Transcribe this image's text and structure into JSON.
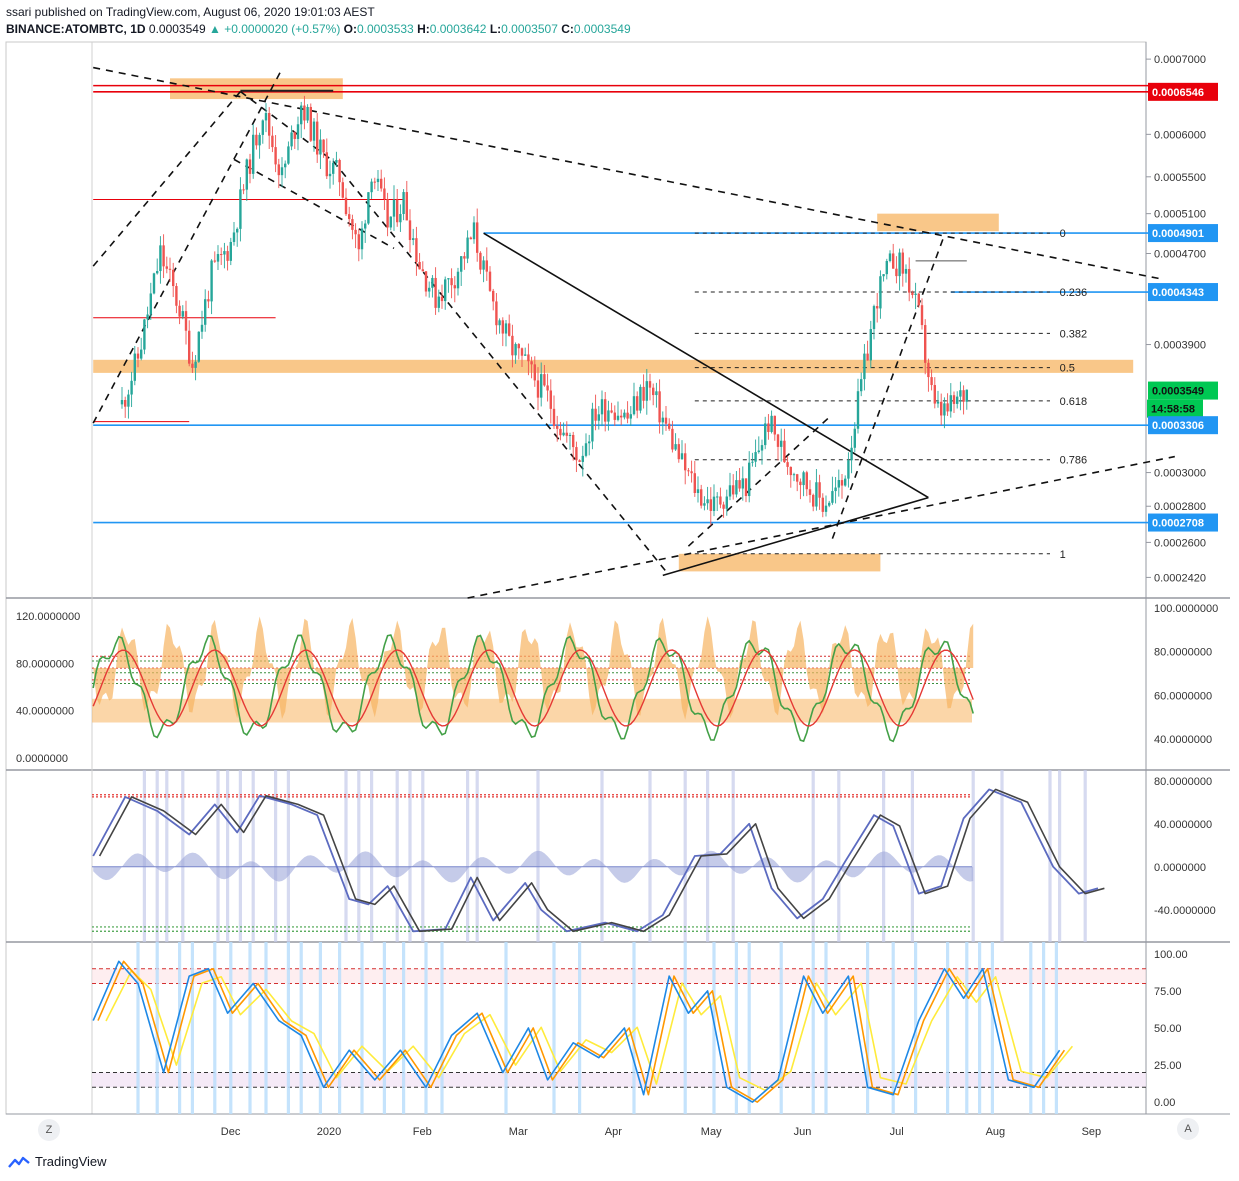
{
  "header": {
    "published_by": "ssari published on TradingView.com, August 06, 2020 19:01:03 AEST",
    "symbol": "BINANCE:ATOMBTC, 1D",
    "last": "0.0003549",
    "change_icon": "triangle-up-icon",
    "change": "+0.0000020 (+0.57%)",
    "o_label": "O:",
    "o": "0.0003533",
    "h_label": "H:",
    "h": "0.0003642",
    "l_label": "L:",
    "l": "0.0003507",
    "c_label": "C:",
    "c": "0.0003549"
  },
  "footer": {
    "brand": "TradingView",
    "left_button": "Z",
    "right_button": "A"
  },
  "colors": {
    "up": "#26a69a",
    "down": "#ef5350",
    "red_line": "#e8000b",
    "blue_line": "#2196f3",
    "zone": "#f7b461",
    "green_label": "#00c853"
  },
  "chart_data": [
    {
      "type": "candlestick",
      "symbol": "BINANCE:ATOMBTC",
      "interval": "1D",
      "x_ticks": [
        "Dec",
        "2020",
        "Feb",
        "Mar",
        "Apr",
        "May",
        "Jun",
        "Jul",
        "Aug",
        "Sep"
      ],
      "y_ticks": [
        "0.0007000",
        "0.0006000",
        "0.0005500",
        "0.0005100",
        "0.0004700",
        "0.0003900",
        "0.0003000",
        "0.0002800",
        "0.0002600",
        "0.0002420"
      ],
      "ylim": [
        0.000232,
        0.000725
      ],
      "y_scale": "log",
      "price_labels": [
        {
          "text": "0.0006546",
          "kind": "red"
        },
        {
          "text": "0.0004901",
          "kind": "blue"
        },
        {
          "text": "0.0004343",
          "kind": "blue"
        },
        {
          "text": "0.0003549",
          "kind": "green"
        },
        {
          "text": "14:58:58",
          "kind": "green"
        },
        {
          "text": "0.0003306",
          "kind": "blue"
        },
        {
          "text": "0.0002708",
          "kind": "blue"
        }
      ],
      "fib_levels": [
        {
          "label": "0",
          "price": 0.0004901
        },
        {
          "label": "0.236",
          "price": 0.0004343
        },
        {
          "label": "0.382",
          "price": 0.000399
        },
        {
          "label": "0.5",
          "price": 0.000372
        },
        {
          "label": "0.618",
          "price": 0.0003475
        },
        {
          "label": "0.786",
          "price": 0.000308
        },
        {
          "label": "1",
          "price": 0.000254
        }
      ],
      "close_path": [
        [
          0,
          0.000345
        ],
        [
          5,
          0.00038
        ],
        [
          12,
          0.00047
        ],
        [
          18,
          0.00042
        ],
        [
          22,
          0.000375
        ],
        [
          28,
          0.00045
        ],
        [
          34,
          0.00048
        ],
        [
          40,
          0.00057
        ],
        [
          44,
          0.00063
        ],
        [
          50,
          0.00055
        ],
        [
          56,
          0.00064
        ],
        [
          63,
          0.00057
        ],
        [
          68,
          0.00055
        ],
        [
          74,
          0.00047
        ],
        [
          78,
          0.00056
        ],
        [
          83,
          0.0005
        ],
        [
          88,
          0.000525
        ],
        [
          93,
          0.00046
        ],
        [
          98,
          0.00043
        ],
        [
          104,
          0.00045
        ],
        [
          110,
          0.00049
        ],
        [
          115,
          0.00043
        ],
        [
          121,
          0.00039
        ],
        [
          127,
          0.00037
        ],
        [
          133,
          0.00035
        ],
        [
          138,
          0.000325
        ],
        [
          143,
          0.00031
        ],
        [
          148,
          0.00034
        ],
        [
          153,
          0.000345
        ],
        [
          158,
          0.000335
        ],
        [
          164,
          0.00036
        ],
        [
          170,
          0.00033
        ],
        [
          175,
          0.000305
        ],
        [
          180,
          0.000288
        ],
        [
          185,
          0.00028
        ],
        [
          190,
          0.00029
        ],
        [
          195,
          0.000293
        ],
        [
          202,
          0.000333
        ],
        [
          207,
          0.00031
        ],
        [
          213,
          0.000295
        ],
        [
          219,
          0.000282
        ],
        [
          225,
          0.000292
        ],
        [
          230,
          0.000345
        ],
        [
          236,
          0.000432
        ],
        [
          241,
          0.000465
        ],
        [
          245,
          0.000452
        ],
        [
          249,
          0.000412
        ],
        [
          254,
          0.00034
        ],
        [
          258,
          0.00034
        ],
        [
          264,
          0.000355
        ]
      ]
    },
    {
      "type": "line",
      "name": "oscillator-1",
      "y_ticks_left": [
        "120.0000000",
        "80.0000000",
        "40.0000000",
        "0.0000000"
      ],
      "y_ticks_right": [
        "100.0000000",
        "80.0000000",
        "60.0000000",
        "40.0000000"
      ],
      "ylim": [
        0,
        120
      ]
    },
    {
      "type": "line",
      "name": "oscillator-2",
      "y_ticks": [
        "80.0000000",
        "40.0000000",
        "0.0000000",
        "-40.0000000"
      ],
      "ylim": [
        -70,
        90
      ],
      "key_points": [
        [
          0,
          10
        ],
        [
          10,
          65
        ],
        [
          20,
          52
        ],
        [
          30,
          30
        ],
        [
          38,
          58
        ],
        [
          45,
          32
        ],
        [
          52,
          66
        ],
        [
          62,
          58
        ],
        [
          70,
          48
        ],
        [
          80,
          -30
        ],
        [
          86,
          -35
        ],
        [
          92,
          -18
        ],
        [
          100,
          -60
        ],
        [
          110,
          -58
        ],
        [
          118,
          -10
        ],
        [
          125,
          -50
        ],
        [
          135,
          -15
        ],
        [
          140,
          -40
        ],
        [
          148,
          -60
        ],
        [
          160,
          -52
        ],
        [
          170,
          -60
        ],
        [
          178,
          -45
        ],
        [
          188,
          10
        ],
        [
          196,
          12
        ],
        [
          205,
          40
        ],
        [
          212,
          -20
        ],
        [
          220,
          -48
        ],
        [
          228,
          -30
        ],
        [
          235,
          5
        ],
        [
          244,
          48
        ],
        [
          250,
          38
        ],
        [
          258,
          -25
        ],
        [
          265,
          -18
        ],
        [
          272,
          45
        ],
        [
          280,
          72
        ],
        [
          290,
          60
        ],
        [
          300,
          0
        ],
        [
          308,
          -25
        ],
        [
          314,
          -20
        ]
      ]
    },
    {
      "type": "line",
      "name": "stochastic",
      "y_ticks": [
        "100.00",
        "75.00",
        "50.00",
        "25.00",
        "0.00"
      ],
      "ylim": [
        -8,
        108
      ],
      "levels": [
        90,
        80,
        20,
        10
      ],
      "key_points": [
        [
          0,
          55
        ],
        [
          8,
          95
        ],
        [
          14,
          80
        ],
        [
          22,
          20
        ],
        [
          30,
          85
        ],
        [
          36,
          90
        ],
        [
          42,
          60
        ],
        [
          50,
          80
        ],
        [
          58,
          55
        ],
        [
          65,
          45
        ],
        [
          72,
          10
        ],
        [
          80,
          35
        ],
        [
          88,
          15
        ],
        [
          96,
          35
        ],
        [
          104,
          10
        ],
        [
          112,
          45
        ],
        [
          120,
          60
        ],
        [
          128,
          20
        ],
        [
          136,
          50
        ],
        [
          142,
          15
        ],
        [
          150,
          40
        ],
        [
          158,
          30
        ],
        [
          166,
          50
        ],
        [
          172,
          5
        ],
        [
          180,
          85
        ],
        [
          186,
          60
        ],
        [
          192,
          75
        ],
        [
          198,
          10
        ],
        [
          206,
          0
        ],
        [
          214,
          15
        ],
        [
          222,
          85
        ],
        [
          228,
          60
        ],
        [
          236,
          85
        ],
        [
          242,
          10
        ],
        [
          250,
          5
        ],
        [
          258,
          55
        ],
        [
          266,
          90
        ],
        [
          272,
          70
        ],
        [
          278,
          90
        ],
        [
          286,
          15
        ],
        [
          294,
          10
        ],
        [
          302,
          35
        ]
      ]
    }
  ]
}
